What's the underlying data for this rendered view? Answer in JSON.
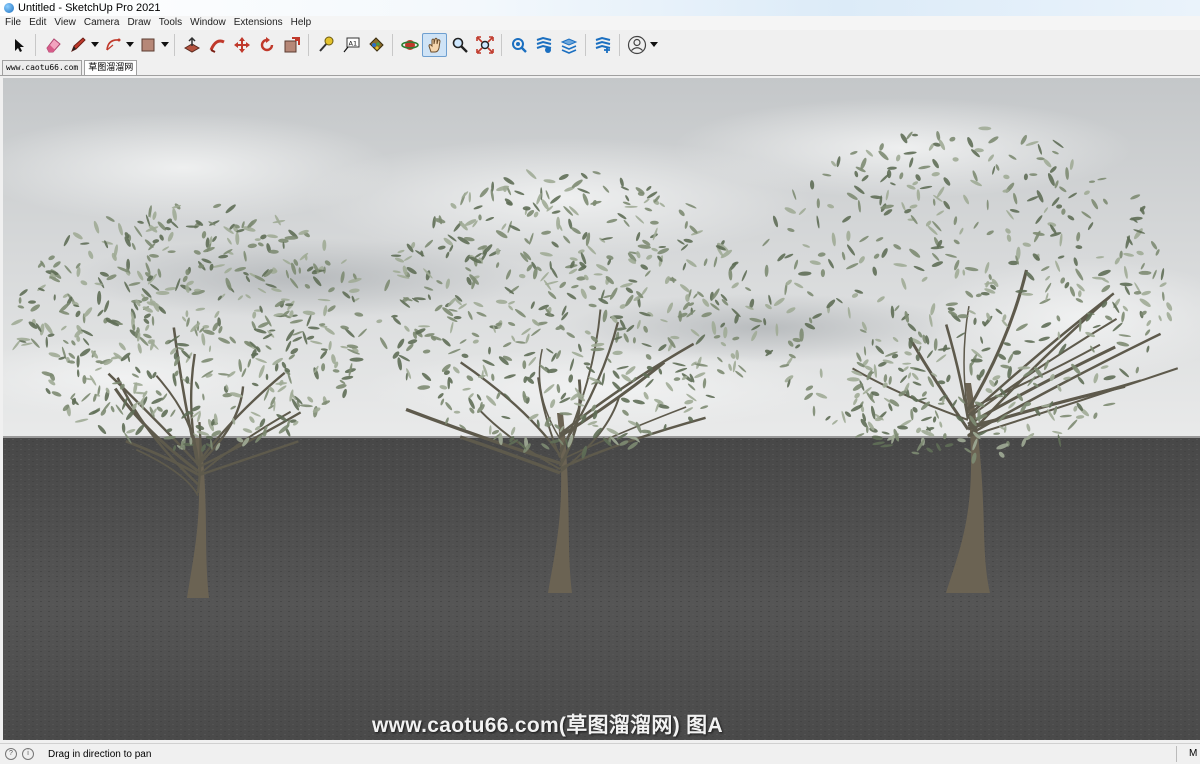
{
  "window": {
    "title": "Untitled - SketchUp Pro 2021"
  },
  "menu": [
    "File",
    "Edit",
    "View",
    "Camera",
    "Draw",
    "Tools",
    "Window",
    "Extensions",
    "Help"
  ],
  "toolbar": {
    "tools": [
      {
        "name": "select-tool",
        "icon": "arrow-cursor-icon"
      },
      {
        "name": "eraser-tool",
        "icon": "eraser-icon"
      },
      {
        "name": "pencil-tool",
        "icon": "pencil-icon"
      },
      {
        "name": "arc-tool",
        "icon": "arc-icon"
      },
      {
        "name": "shape-tool",
        "icon": "rectangle-icon"
      },
      {
        "name": "push-pull-tool",
        "icon": "push-pull-icon"
      },
      {
        "name": "follow-me-tool",
        "icon": "follow-me-icon"
      },
      {
        "name": "move-tool",
        "icon": "move-icon"
      },
      {
        "name": "rotate-tool",
        "icon": "rotate-icon"
      },
      {
        "name": "scale-tool",
        "icon": "scale-icon"
      },
      {
        "name": "tape-measure-tool",
        "icon": "tape-measure-icon"
      },
      {
        "name": "text-tool",
        "icon": "text-icon"
      },
      {
        "name": "paint-bucket-tool",
        "icon": "paint-bucket-icon"
      },
      {
        "name": "orbit-tool",
        "icon": "orbit-icon"
      },
      {
        "name": "pan-tool",
        "icon": "hand-icon"
      },
      {
        "name": "zoom-tool",
        "icon": "magnifier-icon"
      },
      {
        "name": "zoom-extents-tool",
        "icon": "zoom-extents-icon"
      },
      {
        "name": "3d-warehouse-button",
        "icon": "warehouse-icon"
      },
      {
        "name": "extension-warehouse-button",
        "icon": "extension-icon"
      },
      {
        "name": "layout-button",
        "icon": "layers-icon"
      },
      {
        "name": "extension-manager-button",
        "icon": "extension-manager-icon"
      },
      {
        "name": "account-button",
        "icon": "user-icon"
      }
    ],
    "text_tool_label": "A1"
  },
  "tabs": [
    "www.caotu66.com",
    "草图溜溜网"
  ],
  "watermark": "www.caotu66.com(草图溜溜网) 图A",
  "status": {
    "hint": "Drag in direction to pan",
    "measurements_label": "M"
  },
  "colors": {
    "sky": "#d8dadb",
    "ground": "#4e4e4e",
    "foliage": "#7d8b72",
    "trunk": "#6b6353",
    "accent": "#1b6fc0"
  }
}
